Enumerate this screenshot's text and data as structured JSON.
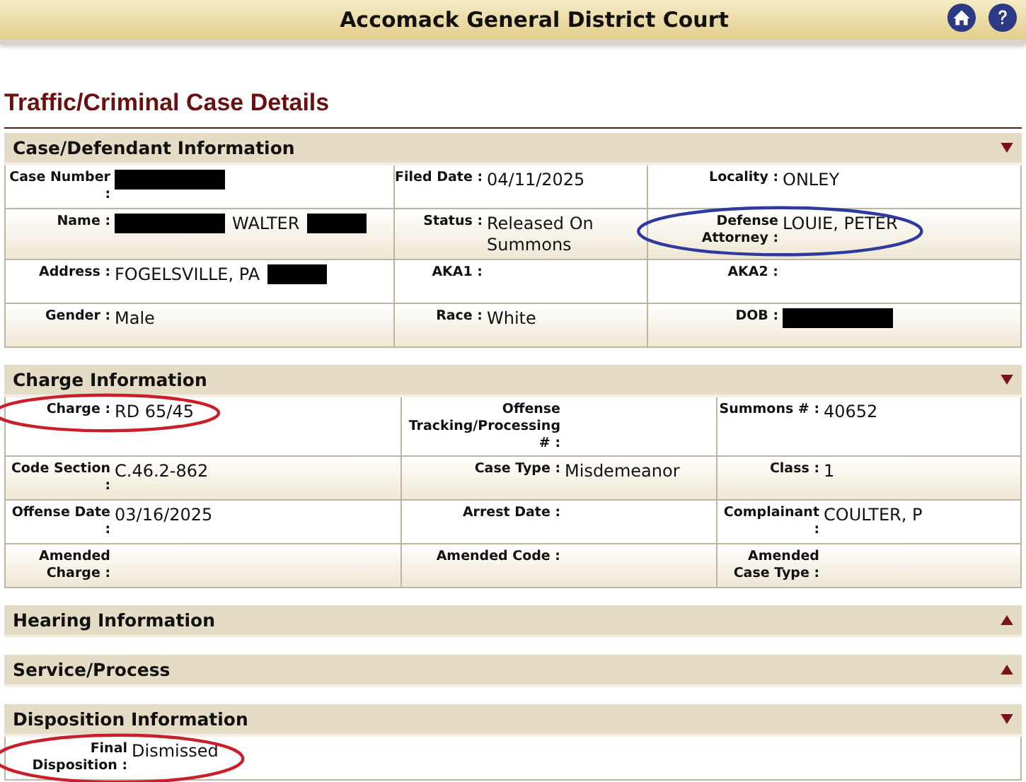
{
  "header": {
    "title": "Accomack General District Court"
  },
  "page_title": "Traffic/Criminal Case Details",
  "sections": [
    {
      "title": "Case/Defendant Information",
      "expanded": true,
      "rows": [
        [
          {
            "label": "Case Number :",
            "parts": [
              {
                "kind": "redaction"
              }
            ]
          },
          {
            "label": "Filed Date :",
            "parts": [
              {
                "kind": "text",
                "text": "04/11/2025"
              }
            ]
          },
          {
            "label": "Locality :",
            "parts": [
              {
                "kind": "text",
                "text": "ONLEY"
              }
            ]
          }
        ],
        [
          {
            "label": "Name :",
            "parts": [
              {
                "kind": "redaction"
              },
              {
                "kind": "text",
                "text": "WALTER"
              },
              {
                "kind": "redaction"
              }
            ]
          },
          {
            "label": "Status :",
            "parts": [
              {
                "kind": "text",
                "text": "Released On Summons"
              }
            ]
          },
          {
            "label": "Defense Attorney :",
            "parts": [
              {
                "kind": "text",
                "text": "LOUIE, PETER"
              }
            ],
            "color": "#2e3a9e"
          }
        ],
        [
          {
            "label": "Address :",
            "parts": [
              {
                "kind": "text",
                "text": "FOGELSVILLE, PA"
              },
              {
                "kind": "redaction"
              }
            ]
          },
          {
            "label": "AKA1 :"
          },
          {
            "label": "AKA2 :"
          }
        ],
        [
          {
            "label": "Gender :",
            "parts": [
              {
                "kind": "text",
                "text": "Male"
              }
            ]
          },
          {
            "label": "Race :",
            "parts": [
              {
                "kind": "text",
                "text": "White"
              }
            ]
          },
          {
            "label": "DOB :",
            "parts": [
              {
                "kind": "redaction"
              }
            ]
          }
        ]
      ]
    },
    {
      "title": "Charge Information",
      "expanded": true,
      "rows": [
        [
          {
            "label": "Charge :",
            "parts": [
              {
                "kind": "text",
                "text": "RD 65/45"
              }
            ],
            "color": "#c8202a"
          },
          {
            "label": "Offense Tracking/Processing # :"
          },
          {
            "label": "Summons # :",
            "parts": [
              {
                "kind": "text",
                "text": "40652"
              }
            ]
          }
        ],
        [
          {
            "label": "Code Section :",
            "parts": [
              {
                "kind": "text",
                "text": "C.46.2-862"
              }
            ]
          },
          {
            "label": "Case Type :",
            "parts": [
              {
                "kind": "text",
                "text": "Misdemeanor"
              }
            ]
          },
          {
            "label": "Class :",
            "parts": [
              {
                "kind": "text",
                "text": "1"
              }
            ]
          }
        ],
        [
          {
            "label": "Offense Date :",
            "parts": [
              {
                "kind": "text",
                "text": "03/16/2025"
              }
            ]
          },
          {
            "label": "Arrest Date :"
          },
          {
            "label": "Complainant :",
            "parts": [
              {
                "kind": "text",
                "text": "COULTER, P"
              }
            ]
          }
        ],
        [
          {
            "label": "Amended Charge :"
          },
          {
            "label": "Amended Code :"
          },
          {
            "label": "Amended Case Type :"
          }
        ]
      ]
    },
    {
      "title": "Hearing Information",
      "expanded": false
    },
    {
      "title": "Service/Process",
      "expanded": false
    },
    {
      "title": "Disposition Information",
      "expanded": true,
      "rows": [
        [
          {
            "label": "Final Disposition :",
            "parts": [
              {
                "kind": "text",
                "text": "Dismissed"
              }
            ],
            "color": "#c8202a"
          }
        ]
      ]
    }
  ]
}
